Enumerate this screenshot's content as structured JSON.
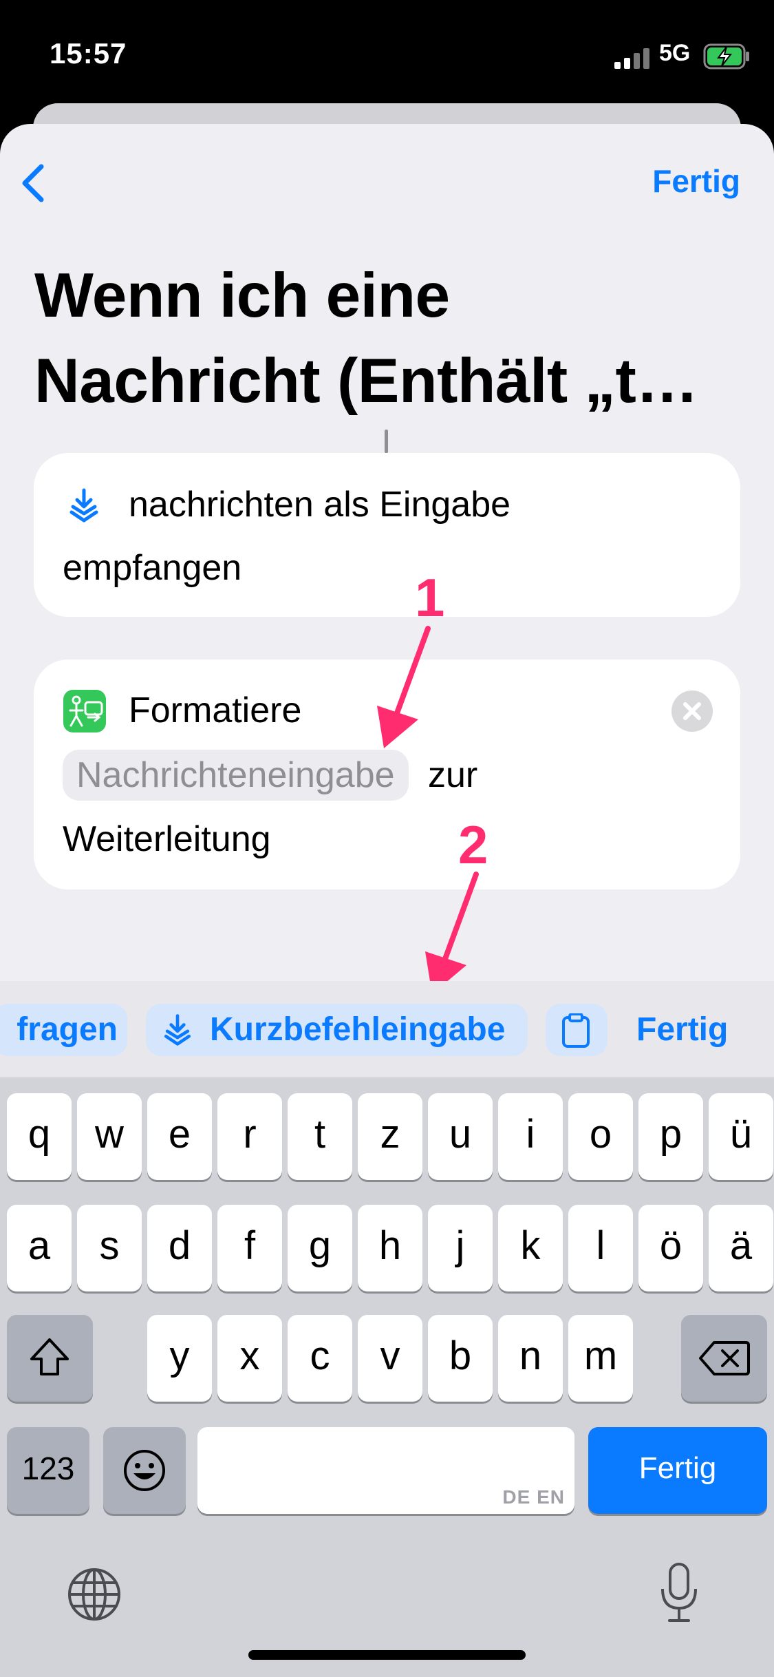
{
  "status": {
    "time": "15:57",
    "network": "5G"
  },
  "header": {
    "done_label": "Fertig"
  },
  "title": {
    "line1": "Wenn ich eine",
    "line2": "Nachricht (Enthält „t…"
  },
  "card1": {
    "text_line1": "nachrichten als Eingabe",
    "text_line2": "empfangen"
  },
  "card2": {
    "verb": "Formatiere",
    "variable": "Nachrichteneingabe",
    "suffix": "zur",
    "text_line3": "Weiterleitung"
  },
  "annotations": {
    "one": "1",
    "two": "2"
  },
  "suggestions": {
    "items": [
      {
        "label": "fragen"
      },
      {
        "label": "Kurzbefehleingabe"
      }
    ],
    "done_label": "Fertig"
  },
  "keyboard": {
    "row1": [
      "q",
      "w",
      "e",
      "r",
      "t",
      "z",
      "u",
      "i",
      "o",
      "p",
      "ü"
    ],
    "row2": [
      "a",
      "s",
      "d",
      "f",
      "g",
      "h",
      "j",
      "k",
      "l",
      "ö",
      "ä"
    ],
    "row3": [
      "y",
      "x",
      "c",
      "v",
      "b",
      "n",
      "m"
    ],
    "numbers_label": "123",
    "space_lang": "DE EN",
    "return_label": "Fertig"
  },
  "colors": {
    "accent": "#0a7aff",
    "annotation": "#ff2d6f",
    "shortcut_green": "#34c759"
  }
}
